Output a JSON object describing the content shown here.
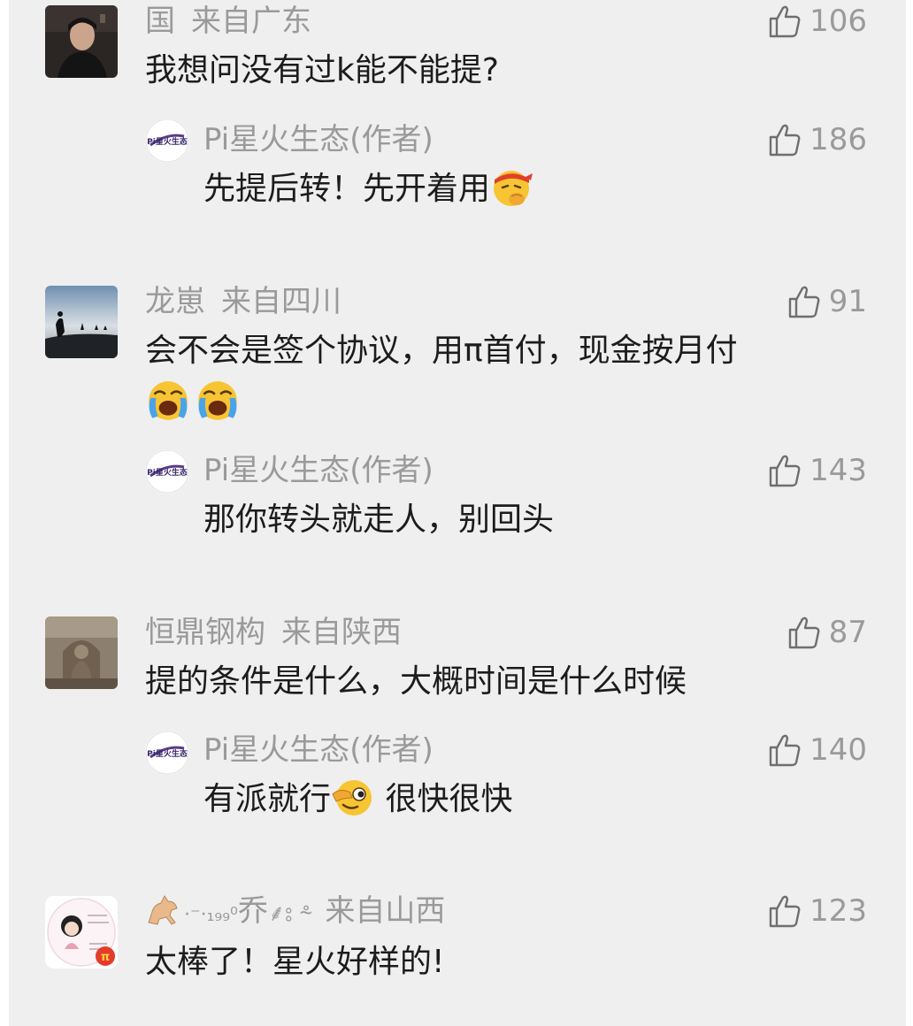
{
  "comments": [
    {
      "username": "国",
      "location": "来自广东",
      "likes": "106",
      "text": "我想问没有过k能不能提?",
      "reply": {
        "author": "Pi星火生态",
        "author_tag": "(作者)",
        "likes": "186",
        "text": "先提后转！先开着用",
        "emoji": "face-with-hand-over-mouth-headband-emoji"
      }
    },
    {
      "username": "龙崽",
      "location": "来自四川",
      "likes": "91",
      "text": "会不会是签个协议，用π首付，现金按月付",
      "emoji": "loudly-crying-face-emoji",
      "reply": {
        "author": "Pi星火生态",
        "author_tag": "(作者)",
        "likes": "143",
        "text": "那你转头就走人，别回头"
      }
    },
    {
      "username": "恒鼎钢构",
      "location": "来自陕西",
      "likes": "87",
      "text": "提的条件是什么，大概时间是什么时候",
      "reply": {
        "author": "Pi星火生态",
        "author_tag": "(作者)",
        "likes": "140",
        "text_before": "有派就行",
        "text_after": " 很快很快",
        "emoji": "face-with-finger-emoji"
      }
    },
    {
      "username_prefix": "·⁻·₁₉₉⁰",
      "username_char": "乔",
      "username_suffix": "⸙⦂ ⸛",
      "location": "来自山西",
      "likes": "123",
      "text": "太棒了！星火好样的!"
    }
  ],
  "avatar_logo_text": "Pi星火生态",
  "like_icon": "thumbs-up-outline-icon",
  "colors": {
    "background": "#efefef",
    "meta": "#9a9a9a",
    "text": "#1c1c1c"
  }
}
